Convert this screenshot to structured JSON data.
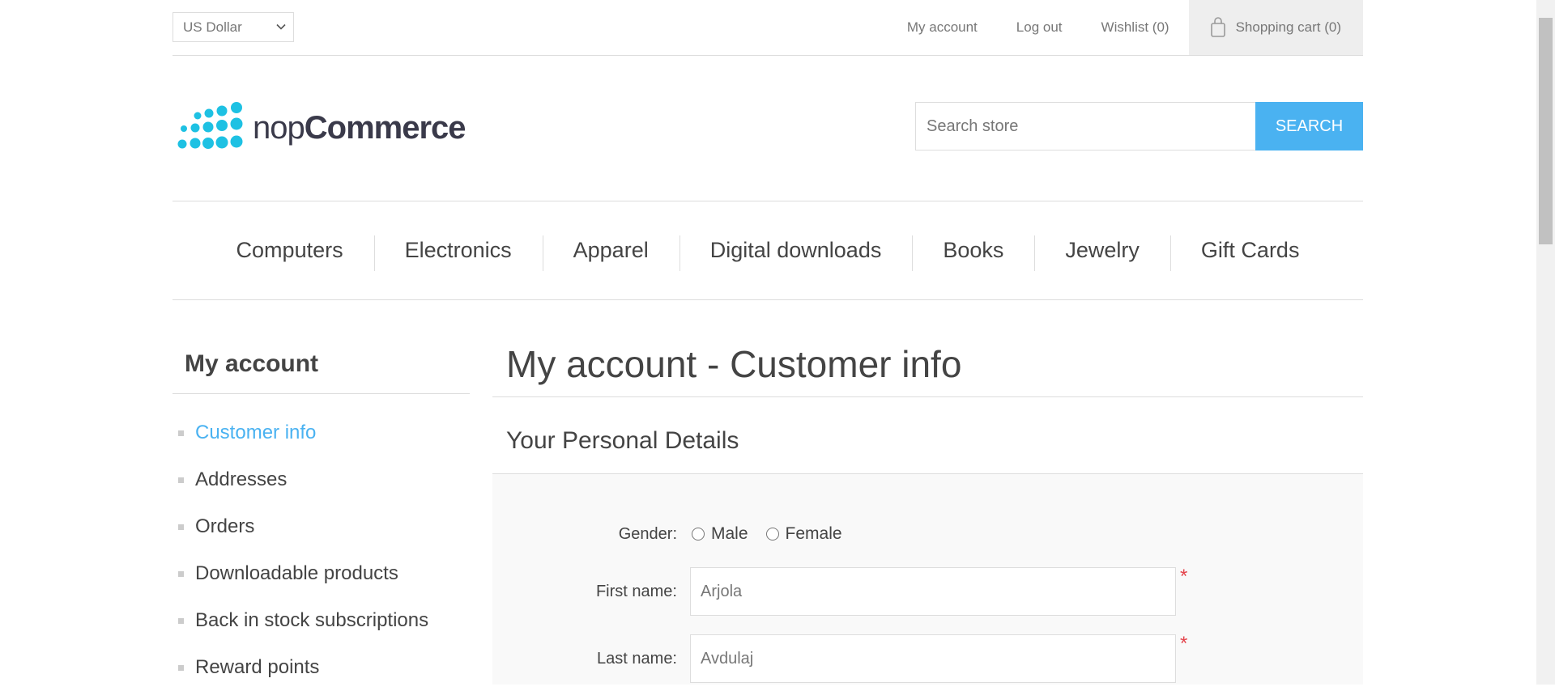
{
  "header": {
    "currency": "US Dollar",
    "links": {
      "my_account": "My account",
      "log_out": "Log out",
      "wishlist": "Wishlist (0)",
      "cart": "Shopping cart (0)"
    }
  },
  "logo": {
    "text_light": "nop",
    "text_bold": "Commerce",
    "color": "#1ec1e3"
  },
  "search": {
    "placeholder": "Search store",
    "button": "SEARCH"
  },
  "menu": {
    "items": [
      "Computers",
      "Electronics",
      "Apparel",
      "Digital downloads",
      "Books",
      "Jewelry",
      "Gift Cards"
    ]
  },
  "sidebar": {
    "title": "My account",
    "items": [
      "Customer info",
      "Addresses",
      "Orders",
      "Downloadable products",
      "Back in stock subscriptions",
      "Reward points"
    ],
    "active_item": "Customer info"
  },
  "main": {
    "page_title": "My account - Customer info",
    "section_title": "Your Personal Details",
    "gender": {
      "label": "Gender:",
      "options": [
        "Male",
        "Female"
      ]
    },
    "first_name": {
      "label": "First name:",
      "value": "Arjola",
      "required_mark": "*"
    },
    "last_name": {
      "label": "Last name:",
      "value": "Avdulaj",
      "required_mark": "*"
    }
  },
  "colors": {
    "accent": "#4ab2f1",
    "required": "#e4444c"
  }
}
